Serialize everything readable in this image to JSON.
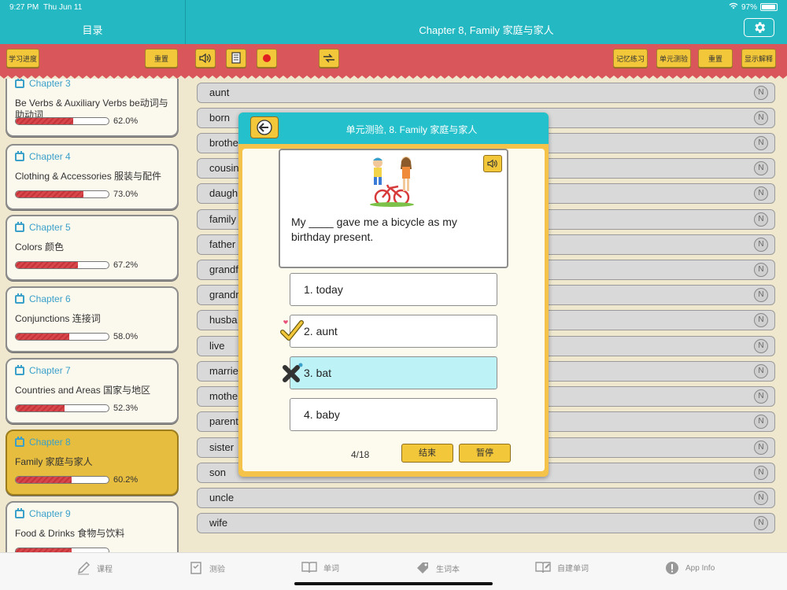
{
  "status": {
    "time": "9:27 PM",
    "date": "Thu Jun 11",
    "battery": "97%"
  },
  "header": {
    "left_title": "目录",
    "right_title": "Chapter 8, Family 家庭与家人"
  },
  "toolbar": {
    "left": {
      "progress": "学习进度",
      "reset": "重置"
    },
    "right": {
      "memory": "记忆练习",
      "unit_test": "单元测验",
      "reset": "重置",
      "show_explain": "显示解释"
    }
  },
  "sidebar": {
    "items": [
      {
        "chapter": "Chapter 3",
        "name": "Be Verbs & Auxiliary Verbs be动词与助动词",
        "progress": 62.0,
        "pct": "62.0%"
      },
      {
        "chapter": "Chapter 4",
        "name": "Clothing & Accessories 服装与配件",
        "progress": 73.0,
        "pct": "73.0%"
      },
      {
        "chapter": "Chapter 5",
        "name": "Colors 颜色",
        "progress": 67.2,
        "pct": "67.2%"
      },
      {
        "chapter": "Chapter 6",
        "name": "Conjunctions 连接词",
        "progress": 58.0,
        "pct": "58.0%"
      },
      {
        "chapter": "Chapter 7",
        "name": "Countries and Areas 国家与地区",
        "progress": 52.3,
        "pct": "52.3%"
      },
      {
        "chapter": "Chapter 8",
        "name": "Family 家庭与家人",
        "progress": 60.2,
        "pct": "60.2%",
        "selected": true
      },
      {
        "chapter": "Chapter 9",
        "name": "Food & Drinks 食物与饮料",
        "progress": 60.4,
        "pct": ""
      }
    ]
  },
  "words": [
    "aunt",
    "born",
    "brothe",
    "cousin",
    "daugh",
    "family",
    "father",
    "grandf",
    "grandr",
    "husba",
    "live",
    "marrie",
    "mothe",
    "parent",
    "sister",
    "son",
    "uncle",
    "wife"
  ],
  "modal": {
    "title": "单元测验, 8. Family 家庭与家人",
    "question": "My ____ gave me a bicycle as my birthday present.",
    "options": [
      "1. today",
      "2. aunt",
      "3. bat",
      "4. baby"
    ],
    "counter": "4/18",
    "end_label": "结束",
    "pause_label": "暂停"
  },
  "tabs": [
    {
      "label": "课程",
      "icon": "pencil-icon"
    },
    {
      "label": "测验",
      "icon": "quiz-icon"
    },
    {
      "label": "单词",
      "icon": "book-icon"
    },
    {
      "label": "生词本",
      "icon": "tag-icon"
    },
    {
      "label": "自建单词",
      "icon": "edit-book-icon"
    },
    {
      "label": "App Info",
      "icon": "info-icon"
    }
  ],
  "colors": {
    "teal": "#24b8c2",
    "red": "#d9575a",
    "yellow": "#f3c73a",
    "selected_card": "#e6bd3e"
  }
}
